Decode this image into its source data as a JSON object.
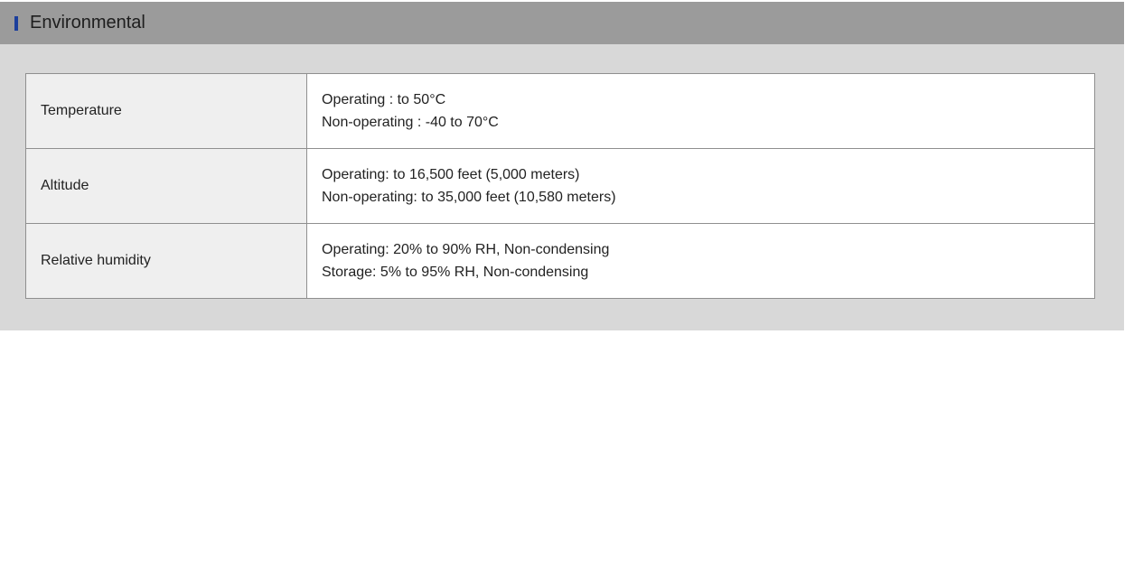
{
  "section": {
    "title": "Environmental",
    "marker_color": "#1c3f9c",
    "header_bg": "#9b9b9b",
    "body_bg": "#d8d8d8"
  },
  "rows": [
    {
      "label": "Temperature",
      "lines": [
        "Operating : to 50°C",
        "Non-operating : -40 to 70°C"
      ]
    },
    {
      "label": "Altitude",
      "lines": [
        "Operating: to 16,500 feet (5,000 meters)",
        "Non-operating: to 35,000 feet (10,580 meters)"
      ]
    },
    {
      "label": "Relative humidity",
      "lines": [
        "Operating: 20% to 90% RH, Non-condensing",
        "Storage: 5% to 95% RH, Non-condensing"
      ]
    }
  ]
}
